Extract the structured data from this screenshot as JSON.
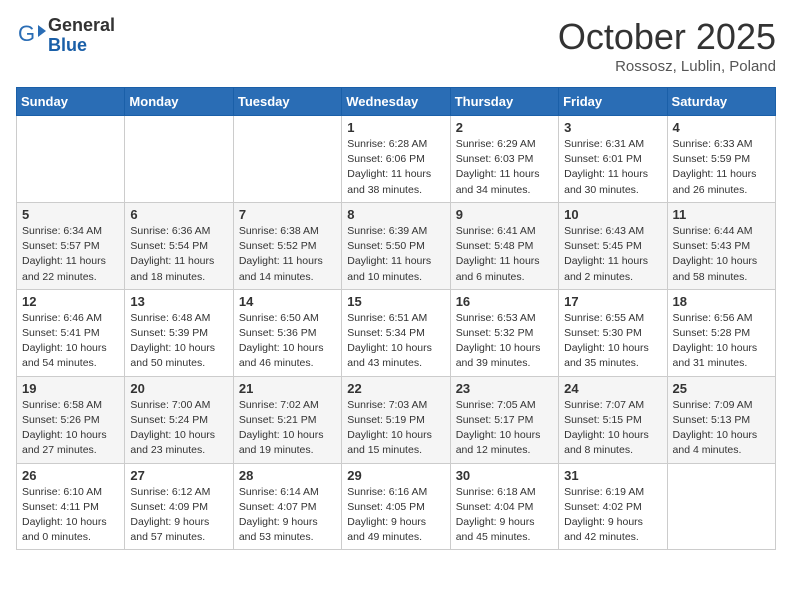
{
  "header": {
    "logo_line1": "General",
    "logo_line2": "Blue",
    "month_title": "October 2025",
    "location": "Rossosz, Lublin, Poland"
  },
  "days_of_week": [
    "Sunday",
    "Monday",
    "Tuesday",
    "Wednesday",
    "Thursday",
    "Friday",
    "Saturday"
  ],
  "weeks": [
    [
      {
        "day": "",
        "info": ""
      },
      {
        "day": "",
        "info": ""
      },
      {
        "day": "",
        "info": ""
      },
      {
        "day": "1",
        "info": "Sunrise: 6:28 AM\nSunset: 6:06 PM\nDaylight: 11 hours\nand 38 minutes."
      },
      {
        "day": "2",
        "info": "Sunrise: 6:29 AM\nSunset: 6:03 PM\nDaylight: 11 hours\nand 34 minutes."
      },
      {
        "day": "3",
        "info": "Sunrise: 6:31 AM\nSunset: 6:01 PM\nDaylight: 11 hours\nand 30 minutes."
      },
      {
        "day": "4",
        "info": "Sunrise: 6:33 AM\nSunset: 5:59 PM\nDaylight: 11 hours\nand 26 minutes."
      }
    ],
    [
      {
        "day": "5",
        "info": "Sunrise: 6:34 AM\nSunset: 5:57 PM\nDaylight: 11 hours\nand 22 minutes."
      },
      {
        "day": "6",
        "info": "Sunrise: 6:36 AM\nSunset: 5:54 PM\nDaylight: 11 hours\nand 18 minutes."
      },
      {
        "day": "7",
        "info": "Sunrise: 6:38 AM\nSunset: 5:52 PM\nDaylight: 11 hours\nand 14 minutes."
      },
      {
        "day": "8",
        "info": "Sunrise: 6:39 AM\nSunset: 5:50 PM\nDaylight: 11 hours\nand 10 minutes."
      },
      {
        "day": "9",
        "info": "Sunrise: 6:41 AM\nSunset: 5:48 PM\nDaylight: 11 hours\nand 6 minutes."
      },
      {
        "day": "10",
        "info": "Sunrise: 6:43 AM\nSunset: 5:45 PM\nDaylight: 11 hours\nand 2 minutes."
      },
      {
        "day": "11",
        "info": "Sunrise: 6:44 AM\nSunset: 5:43 PM\nDaylight: 10 hours\nand 58 minutes."
      }
    ],
    [
      {
        "day": "12",
        "info": "Sunrise: 6:46 AM\nSunset: 5:41 PM\nDaylight: 10 hours\nand 54 minutes."
      },
      {
        "day": "13",
        "info": "Sunrise: 6:48 AM\nSunset: 5:39 PM\nDaylight: 10 hours\nand 50 minutes."
      },
      {
        "day": "14",
        "info": "Sunrise: 6:50 AM\nSunset: 5:36 PM\nDaylight: 10 hours\nand 46 minutes."
      },
      {
        "day": "15",
        "info": "Sunrise: 6:51 AM\nSunset: 5:34 PM\nDaylight: 10 hours\nand 43 minutes."
      },
      {
        "day": "16",
        "info": "Sunrise: 6:53 AM\nSunset: 5:32 PM\nDaylight: 10 hours\nand 39 minutes."
      },
      {
        "day": "17",
        "info": "Sunrise: 6:55 AM\nSunset: 5:30 PM\nDaylight: 10 hours\nand 35 minutes."
      },
      {
        "day": "18",
        "info": "Sunrise: 6:56 AM\nSunset: 5:28 PM\nDaylight: 10 hours\nand 31 minutes."
      }
    ],
    [
      {
        "day": "19",
        "info": "Sunrise: 6:58 AM\nSunset: 5:26 PM\nDaylight: 10 hours\nand 27 minutes."
      },
      {
        "day": "20",
        "info": "Sunrise: 7:00 AM\nSunset: 5:24 PM\nDaylight: 10 hours\nand 23 minutes."
      },
      {
        "day": "21",
        "info": "Sunrise: 7:02 AM\nSunset: 5:21 PM\nDaylight: 10 hours\nand 19 minutes."
      },
      {
        "day": "22",
        "info": "Sunrise: 7:03 AM\nSunset: 5:19 PM\nDaylight: 10 hours\nand 15 minutes."
      },
      {
        "day": "23",
        "info": "Sunrise: 7:05 AM\nSunset: 5:17 PM\nDaylight: 10 hours\nand 12 minutes."
      },
      {
        "day": "24",
        "info": "Sunrise: 7:07 AM\nSunset: 5:15 PM\nDaylight: 10 hours\nand 8 minutes."
      },
      {
        "day": "25",
        "info": "Sunrise: 7:09 AM\nSunset: 5:13 PM\nDaylight: 10 hours\nand 4 minutes."
      }
    ],
    [
      {
        "day": "26",
        "info": "Sunrise: 6:10 AM\nSunset: 4:11 PM\nDaylight: 10 hours\nand 0 minutes."
      },
      {
        "day": "27",
        "info": "Sunrise: 6:12 AM\nSunset: 4:09 PM\nDaylight: 9 hours\nand 57 minutes."
      },
      {
        "day": "28",
        "info": "Sunrise: 6:14 AM\nSunset: 4:07 PM\nDaylight: 9 hours\nand 53 minutes."
      },
      {
        "day": "29",
        "info": "Sunrise: 6:16 AM\nSunset: 4:05 PM\nDaylight: 9 hours\nand 49 minutes."
      },
      {
        "day": "30",
        "info": "Sunrise: 6:18 AM\nSunset: 4:04 PM\nDaylight: 9 hours\nand 45 minutes."
      },
      {
        "day": "31",
        "info": "Sunrise: 6:19 AM\nSunset: 4:02 PM\nDaylight: 9 hours\nand 42 minutes."
      },
      {
        "day": "",
        "info": ""
      }
    ]
  ]
}
